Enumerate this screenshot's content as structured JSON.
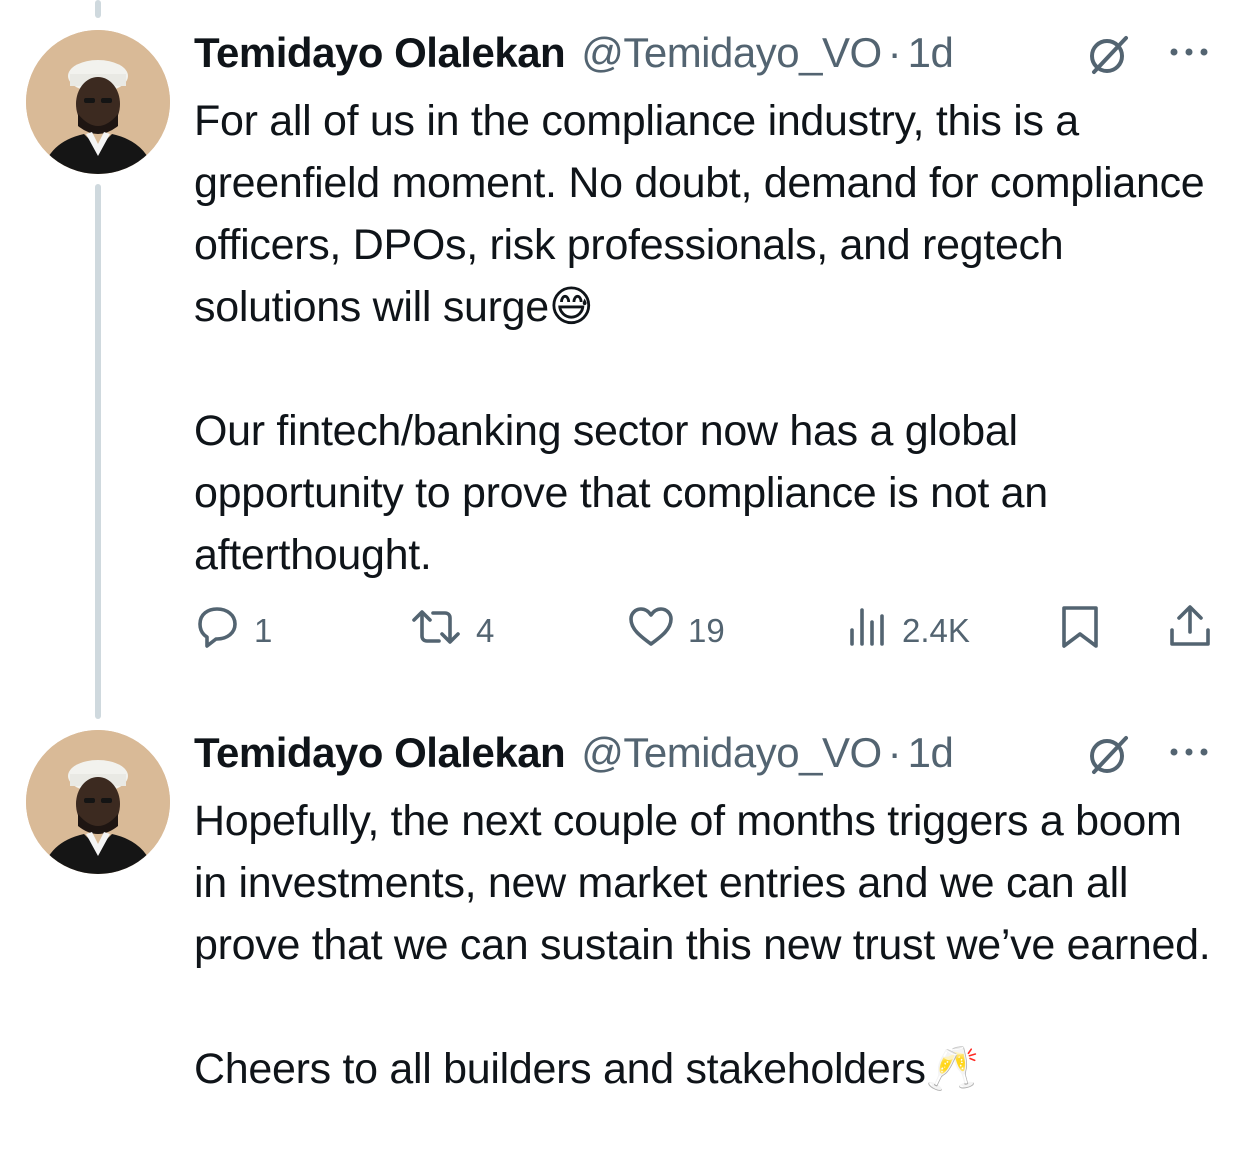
{
  "tweets": [
    {
      "author": {
        "display_name": "Temidayo Olalekan",
        "handle": "@Temidayo_VO",
        "time": "1d",
        "separator": "·"
      },
      "paragraphs": [
        "For all of us in the compliance industry, this is a greenfield moment. No doubt, demand for compliance officers, DPOs, risk professionals, and regtech solutions will surge😅",
        "Our fintech/banking sector now has a global opportunity to prove that compliance is not an afterthought."
      ],
      "actions": {
        "replies": "1",
        "retweets": "4",
        "likes": "19",
        "views": "2.4K"
      }
    },
    {
      "author": {
        "display_name": "Temidayo Olalekan",
        "handle": "@Temidayo_VO",
        "time": "1d",
        "separator": "·"
      },
      "paragraphs": [
        "Hopefully, the next couple of months triggers a boom in investments, new market entries and we can all prove that we can sustain this new trust we’ve earned.",
        "Cheers to all builders and stakeholders🥂"
      ]
    }
  ],
  "icons": {
    "reply": "reply-icon",
    "retweet": "retweet-icon",
    "like": "heart-icon",
    "views": "views-icon",
    "bookmark": "bookmark-icon",
    "share": "share-icon",
    "grok": "grok-icon",
    "more": "more-icon"
  },
  "colors": {
    "text": "#0f1419",
    "secondary": "#536471",
    "thread_line": "#cfd9de",
    "background": "#ffffff"
  }
}
